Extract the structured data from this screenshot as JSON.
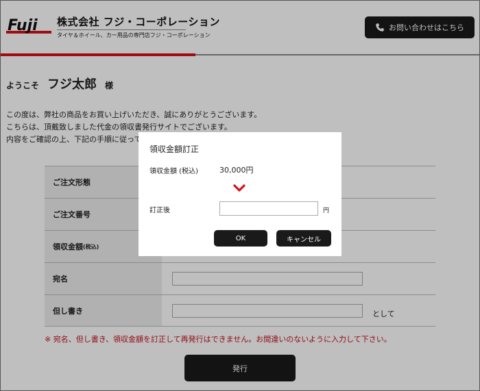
{
  "header": {
    "logo_text": "Fuji",
    "company_name": "株式会社 フジ・コーポレーション",
    "company_sub": "タイヤ＆ホイール、カー用品の専門店フジ・コーポレーション",
    "contact_label": "お問い合わせはこちら",
    "contact_icon": "phone-icon"
  },
  "colors": {
    "brand_red": "#d6101a",
    "button_dark": "#1a1a1a"
  },
  "welcome": {
    "prefix": "ようこそ",
    "name": "フジ太郎",
    "suffix": "様"
  },
  "intro": {
    "line1": "この度は、弊社の商品をお買い上げいただき、誠にありがとうございます。",
    "line2": "こちらは、頂戴致しました代金の領収書発行サイトでございます。",
    "line3": "内容をご確認の上、下記の手順に従って"
  },
  "form": {
    "rows": [
      {
        "label": "ご注文形態",
        "label_note": ""
      },
      {
        "label": "ご注文番号",
        "label_note": ""
      },
      {
        "label": "領収金額",
        "label_note": "(税込)"
      },
      {
        "label": "宛名",
        "label_note": ""
      },
      {
        "label": "但し書き",
        "label_note": ""
      }
    ],
    "recipient_value": "",
    "proviso_value": "",
    "proviso_suffix": "として"
  },
  "warning": "※ 宛名、但し書き、領収金額を訂正して再発行はできません。お間違いのないように入力して下さい。",
  "issue_button": "発行",
  "modal": {
    "title": "領収金額訂正",
    "original_label": "領収金額 (税込)",
    "original_value": "30,000円",
    "arrow_icon": "chevron-down-icon",
    "after_label": "訂正後",
    "after_value": "",
    "unit": "円",
    "ok_label": "OK",
    "cancel_label": "キャンセル"
  }
}
